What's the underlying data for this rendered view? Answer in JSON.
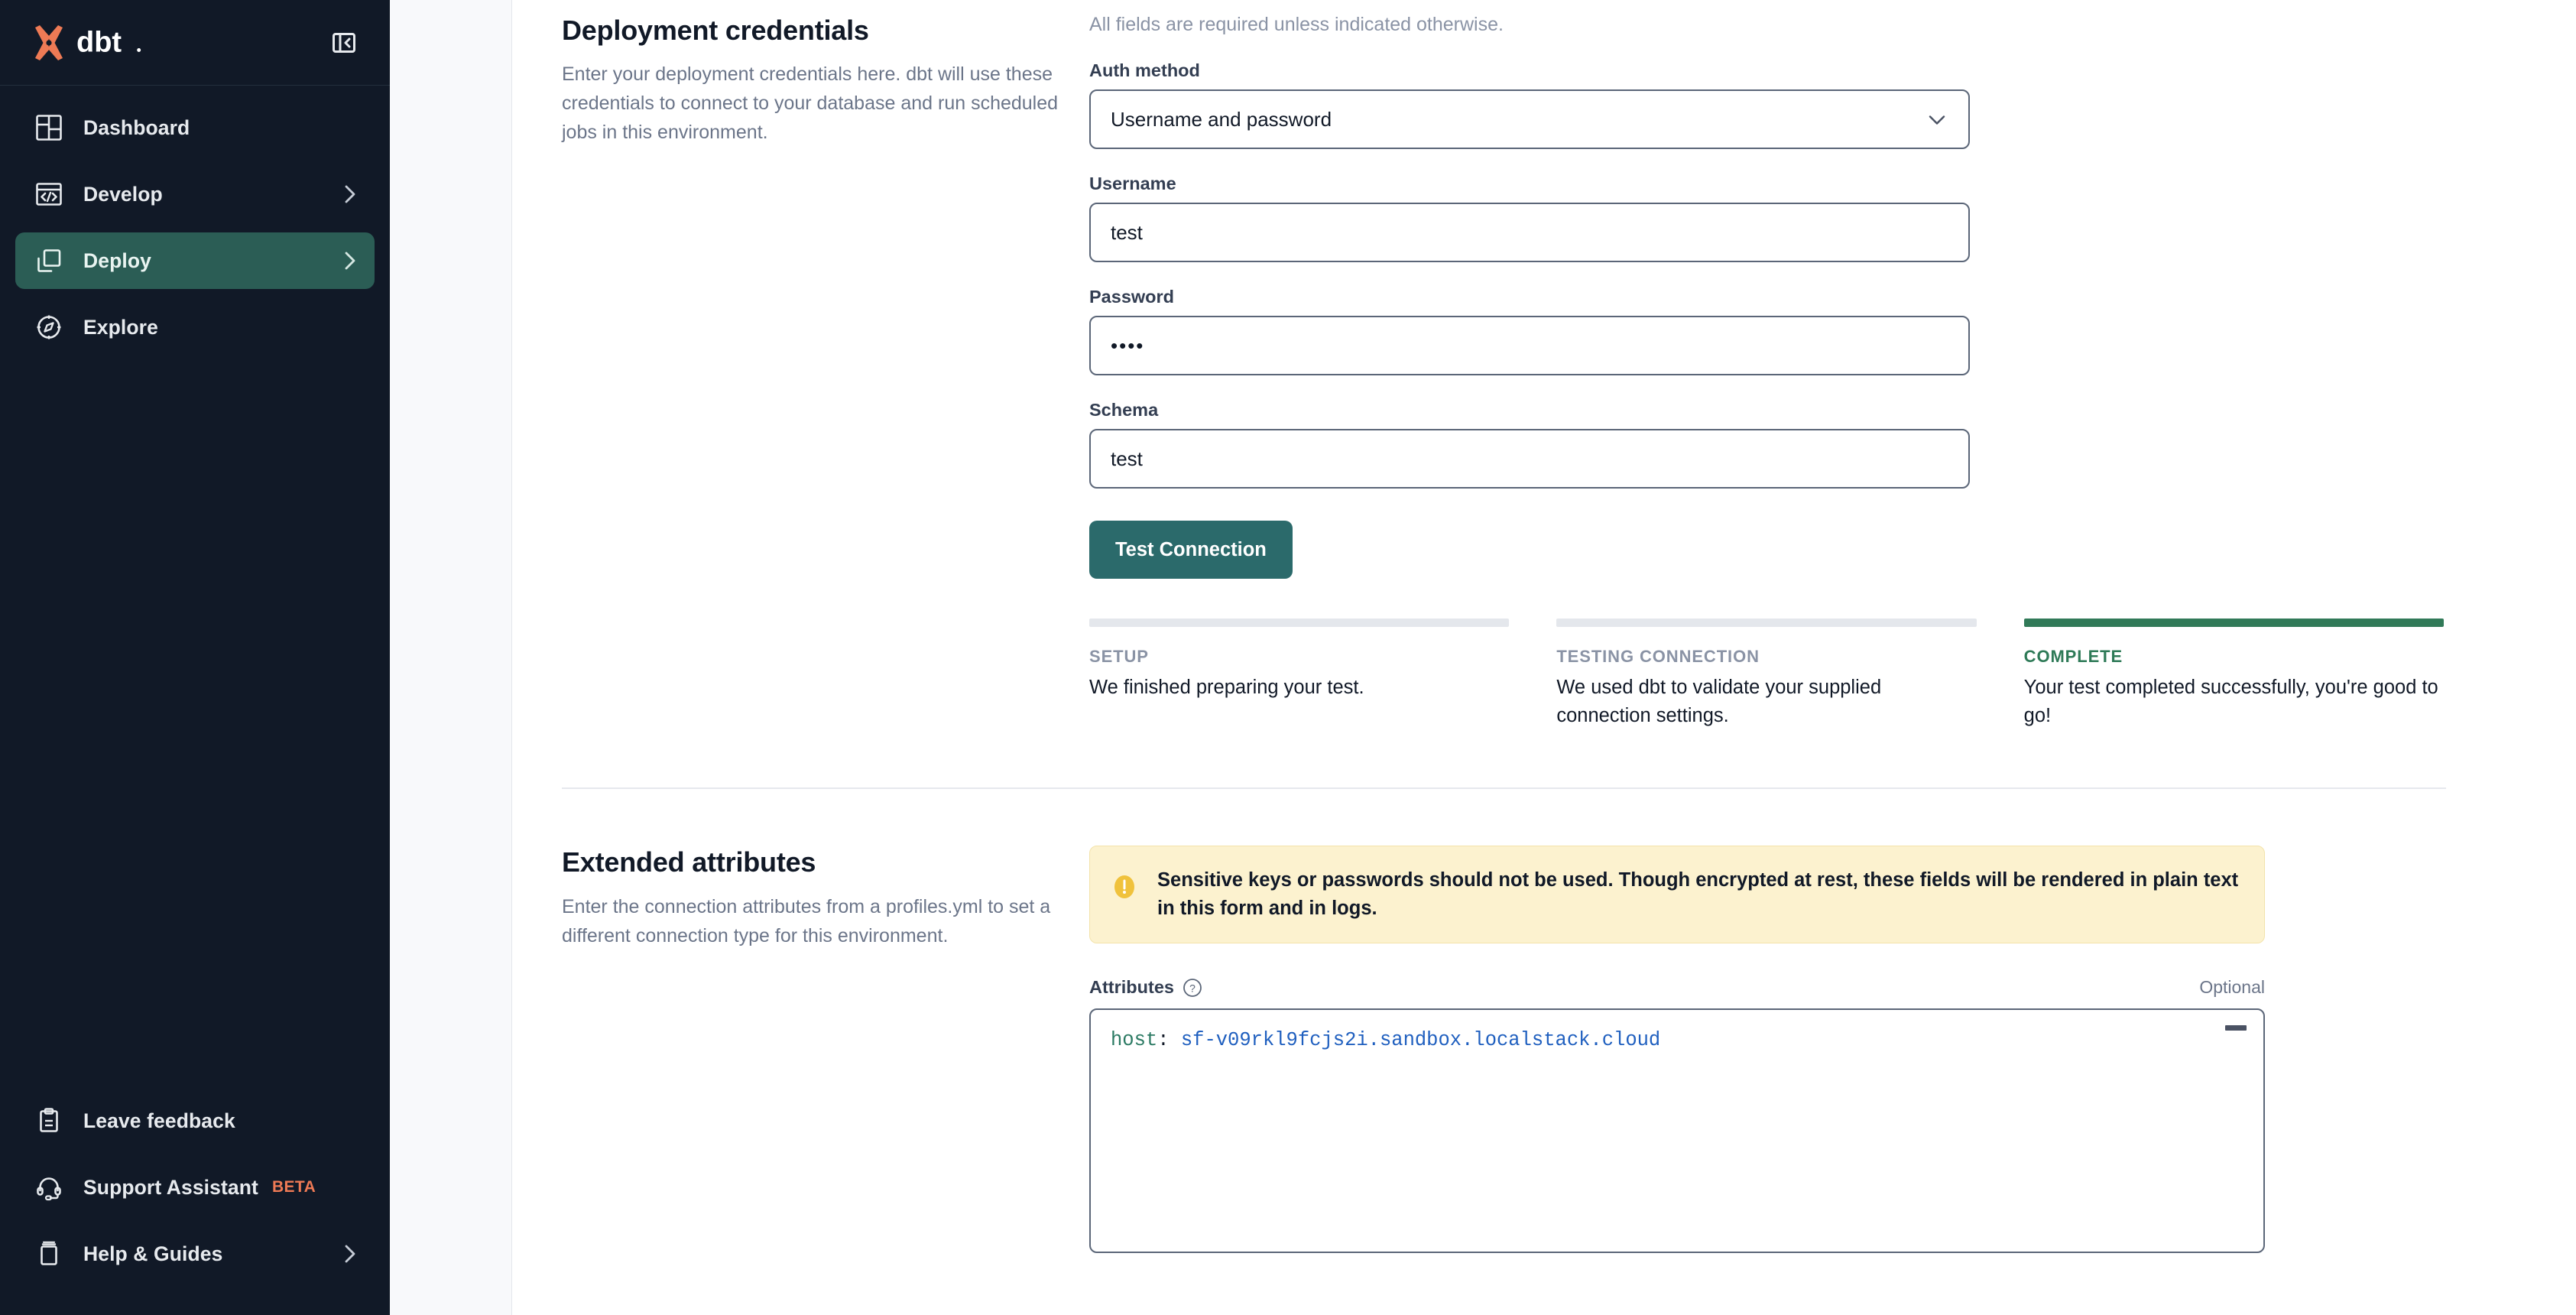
{
  "brand": {
    "name": "dbt",
    "logo_color": "#ee7a55"
  },
  "sidebar": {
    "collapse_icon": "panel-collapse-icon",
    "items": [
      {
        "label": "Dashboard",
        "icon": "dashboard-grid-icon",
        "chevron": false,
        "active": false
      },
      {
        "label": "Develop",
        "icon": "code-window-icon",
        "chevron": true,
        "active": false
      },
      {
        "label": "Deploy",
        "icon": "deploy-squares-icon",
        "chevron": true,
        "active": true
      },
      {
        "label": "Explore",
        "icon": "compass-icon",
        "chevron": false,
        "active": false
      }
    ],
    "footer_items": [
      {
        "label": "Leave feedback",
        "icon": "clipboard-icon",
        "chevron": false,
        "badge": ""
      },
      {
        "label": "Support Assistant",
        "icon": "headset-icon",
        "chevron": false,
        "badge": "BETA"
      },
      {
        "label": "Help & Guides",
        "icon": "book-icon",
        "chevron": true,
        "badge": ""
      }
    ],
    "badge_color": "#ef7a55",
    "active_color": "#2b5d55"
  },
  "credentials": {
    "title": "Deployment credentials",
    "description": "Enter your deployment credentials here. dbt will use these credentials to connect to your database and run scheduled jobs in this environment.",
    "required_note": "All fields are required unless indicated otherwise.",
    "fields": [
      {
        "label": "Auth method",
        "value": "Username and password",
        "type": "select",
        "name": "auth-method"
      },
      {
        "label": "Username",
        "value": "test",
        "type": "text",
        "name": "username"
      },
      {
        "label": "Password",
        "value": "••••",
        "type": "password",
        "name": "password"
      },
      {
        "label": "Schema",
        "value": "test",
        "type": "text",
        "name": "schema"
      }
    ],
    "test_button": "Test Connection",
    "button_color": "#2b6a6b",
    "steps": [
      {
        "kicker": "SETUP",
        "text": "We finished preparing your test.",
        "done": false
      },
      {
        "kicker": "TESTING CONNECTION",
        "text": "We used dbt to validate your supplied connection settings.",
        "done": false
      },
      {
        "kicker": "COMPLETE",
        "text": "Your test completed successfully, you're good to go!",
        "done": true
      }
    ],
    "complete_color": "#317a58"
  },
  "extended": {
    "title": "Extended attributes",
    "description": "Enter the connection attributes from a profiles.yml to set a different connection type for this environment.",
    "warning": "Sensitive keys or passwords should not be used. Though encrypted at rest, these fields will be rendered in plain text in this form and in logs.",
    "warning_bg": "#fcf2cf",
    "attributes_label": "Attributes",
    "optional_label": "Optional",
    "code": {
      "key": "host",
      "colon": ":",
      "value": " sf-v09rkl9fcjs2i.sandbox.localstack.cloud"
    }
  }
}
